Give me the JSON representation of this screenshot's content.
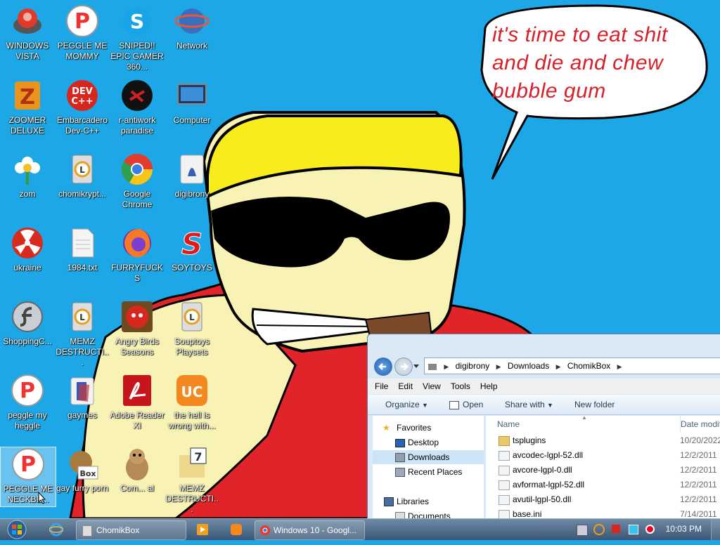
{
  "speech_bubble": {
    "line1": "it's time to eat shit",
    "line2": "and die and chew",
    "line3": "bubble gum"
  },
  "desktop_icons": [
    {
      "label": "WINDOWS VISTA",
      "icon": "vista-orb-icon"
    },
    {
      "label": "PEGGLE ME MOMMY",
      "icon": "peggle-icon"
    },
    {
      "label": "SNIPED!! EPIC GAMER 360...",
      "icon": "skype-icon"
    },
    {
      "label": "Network",
      "icon": "network-globe-icon"
    },
    {
      "label": "ZOOMER DELUXE",
      "icon": "zuma-icon"
    },
    {
      "label": "Embarcadero Dev-C++",
      "icon": "devcpp-icon"
    },
    {
      "label": "r-antiwork paradise",
      "icon": "antiwork-icon"
    },
    {
      "label": "Computer",
      "icon": "computer-icon"
    },
    {
      "label": "zom",
      "icon": "flower-icon"
    },
    {
      "label": "chomikrypt...",
      "icon": "chomik-icon"
    },
    {
      "label": "Google Chrome",
      "icon": "chrome-icon"
    },
    {
      "label": "digibrony",
      "icon": "user-folder-icon"
    },
    {
      "label": "ukraine",
      "icon": "radiation-icon"
    },
    {
      "label": "1984.txt",
      "icon": "text-file-icon"
    },
    {
      "label": "FURRYFUCKS",
      "icon": "firefox-icon"
    },
    {
      "label": "SOYTOYS",
      "icon": "soytoys-icon"
    },
    {
      "label": "ShoppingC...",
      "icon": "flash-icon"
    },
    {
      "label": "MEMZ DESTRUCTI...",
      "icon": "chomik-icon"
    },
    {
      "label": "Angry Birds Seasons",
      "icon": "angry-birds-icon"
    },
    {
      "label": "Souptoys Playsets",
      "icon": "chomik-icon"
    },
    {
      "label": "peggle my heggle",
      "icon": "peggle-icon"
    },
    {
      "label": "gaymes",
      "icon": "games-folder-icon"
    },
    {
      "label": "Adobe Reader XI",
      "icon": "adobe-reader-icon"
    },
    {
      "label": "the hell is wrong with...",
      "icon": "uc-browser-icon"
    },
    {
      "label": "PEGGLE ME NECKBE...",
      "icon": "peggle-icon"
    },
    {
      "label": "gay furry porn",
      "icon": "box-icon"
    },
    {
      "label": "Com... al",
      "icon": "hamster-icon"
    },
    {
      "label": "MEMZ DESTRUCTI...",
      "icon": "memz-file-icon"
    }
  ],
  "explorer": {
    "breadcrumb": [
      "digibrony",
      "Downloads",
      "ChomikBox"
    ],
    "menu": [
      "File",
      "Edit",
      "View",
      "Tools",
      "Help"
    ],
    "toolbar": {
      "organize": "Organize",
      "open": "Open",
      "share": "Share with",
      "new_folder": "New folder"
    },
    "nav": {
      "favorites": "Favorites",
      "items": [
        "Desktop",
        "Downloads",
        "Recent Places"
      ],
      "libraries": "Libraries",
      "documents": "Documents"
    },
    "columns": {
      "name": "Name",
      "date": "Date modif"
    },
    "files": [
      {
        "name": "tsplugins",
        "date": "10/20/2022",
        "folder": true
      },
      {
        "name": "avcodec-lgpl-52.dll",
        "date": "12/2/2011"
      },
      {
        "name": "avcore-lgpl-0.dll",
        "date": "12/2/2011"
      },
      {
        "name": "avformat-lgpl-52.dll",
        "date": "12/2/2011"
      },
      {
        "name": "avutil-lgpl-50.dll",
        "date": "12/2/2011"
      },
      {
        "name": "base.ini",
        "date": "7/14/2011"
      }
    ]
  },
  "taskbar": {
    "chomikbox": "ChomikBox",
    "chrome": "Windows 10 - Googl...",
    "time": "10:03 PM"
  }
}
